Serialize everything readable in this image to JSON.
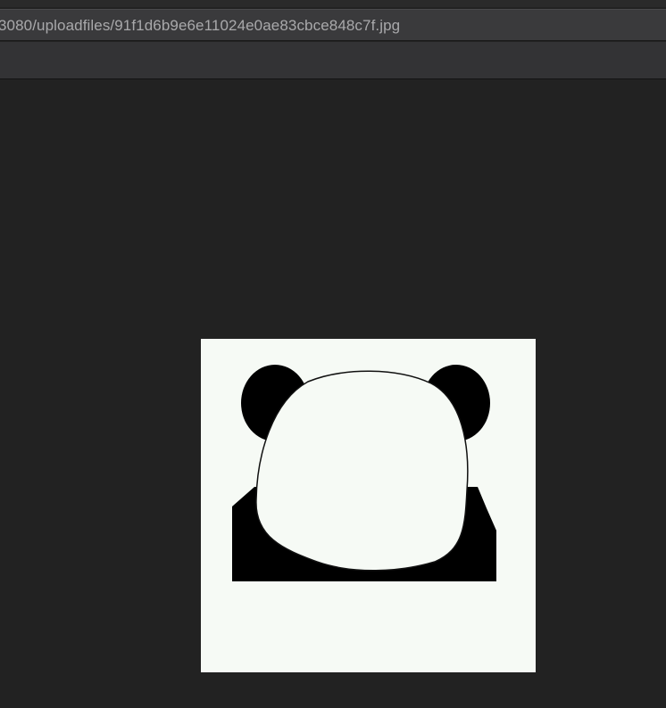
{
  "browser": {
    "url_visible": "3080/uploadfiles/91f1d6b9e6e11024e0ae83cbce848c7f.jpg"
  },
  "image": {
    "subject": "panda-face-meme",
    "background_color": "#f6faf5",
    "ink_color": "#000000"
  },
  "colors": {
    "page_background": "#222222",
    "address_bar": "#3a3a3c",
    "address_text": "#a9a9ab",
    "toolbar": "#333335"
  }
}
